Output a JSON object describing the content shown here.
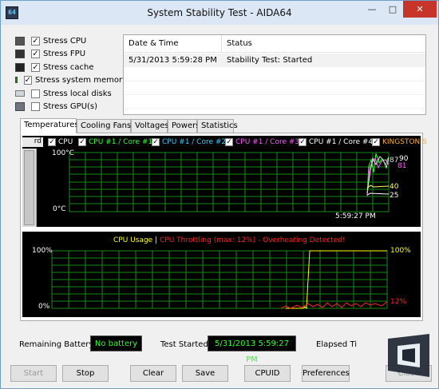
{
  "window": {
    "title": "System Stability Test - AIDA64",
    "app_icon_text": "64",
    "minimize_label": "—",
    "maximize_label": "□",
    "close_label": "✕"
  },
  "stress_options": [
    {
      "label": "Stress CPU",
      "checked": true,
      "icon": "cpu-chip-icon"
    },
    {
      "label": "Stress FPU",
      "checked": true,
      "icon": "fpu-chip-icon"
    },
    {
      "label": "Stress cache",
      "checked": true,
      "icon": "cache-chip-icon"
    },
    {
      "label": "Stress system memory",
      "checked": true,
      "icon": "memory-module-icon"
    },
    {
      "label": "Stress local disks",
      "checked": false,
      "icon": "hard-disk-icon"
    },
    {
      "label": "Stress GPU(s)",
      "checked": false,
      "icon": "gpu-card-icon"
    }
  ],
  "status_table": {
    "columns": [
      "Date & Time",
      "Status"
    ],
    "rows": [
      {
        "datetime": "5/31/2013 5:59:28 PM",
        "status": "Stability Test: Started"
      }
    ]
  },
  "tabs": [
    "Temperatures",
    "Cooling Fans",
    "Voltages",
    "Powers",
    "Statistics"
  ],
  "active_tab": "Temperatures",
  "temperature_graph": {
    "scroll_tab_label": "rd",
    "legend": [
      {
        "label": "CPU",
        "color": "#ffffff",
        "checked": true
      },
      {
        "label": "CPU #1 / Core #1",
        "color": "#33ff33",
        "checked": true
      },
      {
        "label": "CPU #1 / Core #2",
        "color": "#33ccff",
        "checked": true
      },
      {
        "label": "CPU #1 / Core #3",
        "color": "#ff55ff",
        "checked": true
      },
      {
        "label": "CPU #1 / Core #4",
        "color": "#ffffff",
        "checked": true
      },
      {
        "label": "KINGSTON S",
        "color": "#ffaa33",
        "checked": true
      }
    ],
    "y_top_label": "100°C",
    "y_bottom_label": "0°C",
    "time_label": "5:59:27 PM",
    "right_values": [
      {
        "text": "87",
        "color": "#dddddd"
      },
      {
        "text": "90",
        "color": "#ffffff"
      },
      {
        "text": "81",
        "color": "#ff55ff"
      },
      {
        "text": "40",
        "color": "#ffff66"
      },
      {
        "text": "25",
        "color": "#ffffff"
      }
    ],
    "grid_color": "#138c13",
    "accent_color": "#33ff33"
  },
  "cpu_graph": {
    "title_usage": "CPU Usage",
    "title_separator": "|",
    "title_throttle": "CPU Throttling (max: 12%) - Overheating Detected!",
    "y_top_label": "100%",
    "y_bottom_label": "0%",
    "usage_value": "100%",
    "throttle_value": "12%",
    "usage_color": "#ffff00",
    "throttle_color": "#ff2020"
  },
  "info": {
    "battery_label": "Remaining Battery:",
    "battery_value": "No battery",
    "test_started_label": "Test Started:",
    "test_started_value": "5/31/2013 5:59:27 PM",
    "elapsed_label": "Elapsed Ti"
  },
  "buttons": {
    "start": "Start",
    "stop": "Stop",
    "clear": "Clear",
    "save": "Save",
    "cpuid": "CPUID",
    "preferences": "Preferences",
    "close": "Close"
  }
}
